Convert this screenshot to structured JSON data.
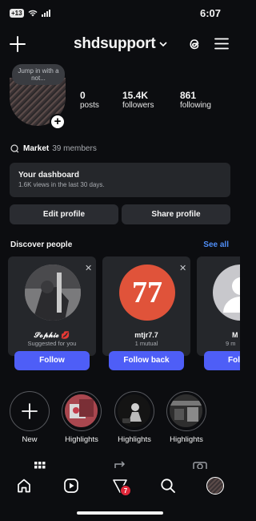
{
  "status": {
    "time": "6:07",
    "badge": "+13"
  },
  "header": {
    "username": "shdsupport"
  },
  "profile": {
    "note": "Jump in with a not...",
    "stats": [
      {
        "value": "0",
        "label": "posts"
      },
      {
        "value": "15.4K",
        "label": "followers"
      },
      {
        "value": "861",
        "label": "following"
      }
    ],
    "market_name": "Market",
    "market_members": "39 members"
  },
  "dashboard": {
    "title": "Your dashboard",
    "subtitle": "1.6K views in the last 30 days."
  },
  "buttons": {
    "edit": "Edit profile",
    "share": "Share profile"
  },
  "discover": {
    "title": "Discover people",
    "see_all": "See all",
    "cards": [
      {
        "name": "𝓢𝓸𝓹𝓱𝓲𝓮 💋",
        "sub": "Suggested for you",
        "action": "Follow"
      },
      {
        "name": "mtjr7.7",
        "sub": "1 mutual",
        "action": "Follow back",
        "avatar_text": "77"
      },
      {
        "name": "M",
        "sub": "9 m",
        "action": "Fol"
      }
    ]
  },
  "highlights": [
    {
      "label": "New"
    },
    {
      "label": "Highlights"
    },
    {
      "label": "Highlights"
    },
    {
      "label": "Highlights"
    }
  ],
  "nav": {
    "notification_count": "7"
  },
  "colors": {
    "accent": "#4e5ef7",
    "link": "#4f8ef7",
    "badge": "#e0283a",
    "avatar77": "#e0533a"
  }
}
